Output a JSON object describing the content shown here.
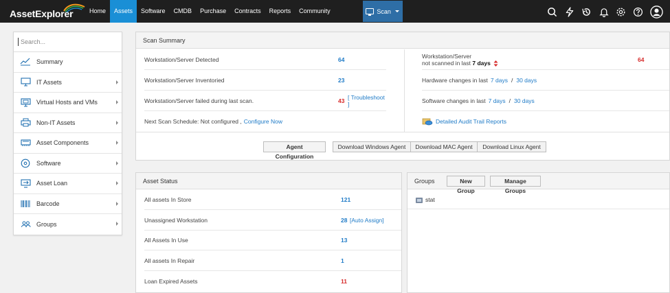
{
  "app": {
    "logo_text": "AssetExplorer",
    "accent_color": "#1a8fd6"
  },
  "nav": {
    "items": [
      {
        "label": "Home"
      },
      {
        "label": "Assets"
      },
      {
        "label": "Software"
      },
      {
        "label": "CMDB"
      },
      {
        "label": "Purchase"
      },
      {
        "label": "Contracts"
      },
      {
        "label": "Reports"
      },
      {
        "label": "Community"
      }
    ],
    "active": "Assets",
    "scan_label": "Scan",
    "icons": [
      "search-icon",
      "lightning-icon",
      "history-icon",
      "bell-icon",
      "gear-icon",
      "help-icon",
      "user-avatar-icon"
    ]
  },
  "sidebar": {
    "search_placeholder": "Search...",
    "items": [
      {
        "label": "Summary",
        "icon": "line-chart-icon",
        "has_arrow": false
      },
      {
        "label": "IT Assets",
        "icon": "monitor-icon",
        "has_arrow": true
      },
      {
        "label": "Virtual Hosts and VMs",
        "icon": "virtual-host-icon",
        "has_arrow": true
      },
      {
        "label": "Non-IT Assets",
        "icon": "printer-icon",
        "has_arrow": true
      },
      {
        "label": "Asset Components",
        "icon": "component-icon",
        "has_arrow": true
      },
      {
        "label": "Software",
        "icon": "disc-icon",
        "has_arrow": true
      },
      {
        "label": "Asset Loan",
        "icon": "asset-loan-icon",
        "has_arrow": true
      },
      {
        "label": "Barcode",
        "icon": "barcode-icon",
        "has_arrow": true
      },
      {
        "label": "Groups",
        "icon": "groups-icon",
        "has_arrow": true
      }
    ]
  },
  "scan_summary": {
    "title": "Scan Summary",
    "left_rows": [
      {
        "label": "Workstation/Server Detected",
        "value": "64"
      },
      {
        "label": "Workstation/Server Inventoried",
        "value": "23"
      },
      {
        "label": "Workstation/Server failed during last scan.",
        "value": "43",
        "link": "[ Troubleshoot ]"
      }
    ],
    "next_scan": {
      "label": "Next Scan Schedule: Not configured ,",
      "link": "Configure Now"
    },
    "right_rows": {
      "not_scanned": {
        "line1": "Workstation/Server",
        "line2": "not scanned in last",
        "days": "7 days",
        "value": "64"
      },
      "hardware": {
        "label": "Hardware changes in last",
        "link1": "7 days",
        "sep": "/",
        "link2": "30 days"
      },
      "software": {
        "label": "Software changes in last",
        "link1": "7 days",
        "sep": "/",
        "link2": "30 days"
      },
      "audit": {
        "label": "Detailed Audit Trail Reports"
      }
    },
    "buttons": {
      "agent_config": "Agent Configuration",
      "download_windows": "Download Windows Agent",
      "download_mac": "Download MAC Agent",
      "download_linux": "Download Linux Agent"
    }
  },
  "asset_status": {
    "title": "Asset Status",
    "rows": [
      {
        "label": "All assets In Store",
        "value": "121",
        "color": "blue"
      },
      {
        "label": "Unassigned Workstation",
        "value": "28",
        "link": "[Auto Assign]",
        "color": "blue"
      },
      {
        "label": "All Assets In Use",
        "value": "13",
        "color": "blue"
      },
      {
        "label": "All assets In Repair",
        "value": "1",
        "color": "blue"
      },
      {
        "label": "Loan Expired Assets",
        "value": "11",
        "color": "red"
      }
    ]
  },
  "groups": {
    "title": "Groups",
    "new_group": "New Group",
    "manage_groups": "Manage Groups",
    "items": [
      {
        "label": "stat"
      }
    ]
  }
}
